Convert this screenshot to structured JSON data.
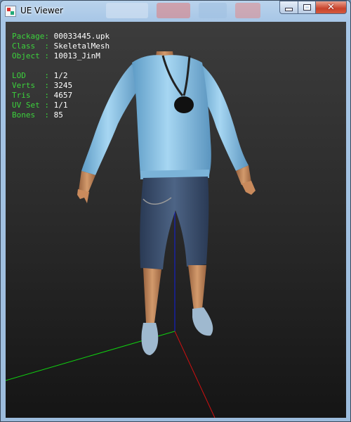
{
  "window": {
    "title": "UE Viewer"
  },
  "mesh_info": {
    "package": {
      "key": "Package:",
      "value": "00033445.upk"
    },
    "class": {
      "key": "Class  :",
      "value": "SkeletalMesh"
    },
    "object": {
      "key": "Object :",
      "value": "10013_JinM"
    },
    "lod": {
      "key": "LOD    :",
      "value": "1/2"
    },
    "verts": {
      "key": "Verts  :",
      "value": "3245"
    },
    "tris": {
      "key": "Tris   :",
      "value": "4657"
    },
    "uvset": {
      "key": "UV Set :",
      "value": "1/1"
    },
    "bones": {
      "key": "Bones  :",
      "value": "85"
    }
  },
  "colors": {
    "label_green": "#3cd23c",
    "value_white": "#ffffff",
    "axis_x": "#d01010",
    "axis_y": "#10d010",
    "axis_z": "#1020e0",
    "sweater": "#8cc4e6",
    "jeans": "#3a4f70",
    "skin": "#c98a5c"
  },
  "icons": {
    "app": "ue-viewer-app-icon",
    "minimize": "minimize-icon",
    "maximize": "maximize-icon",
    "close": "close-icon"
  }
}
